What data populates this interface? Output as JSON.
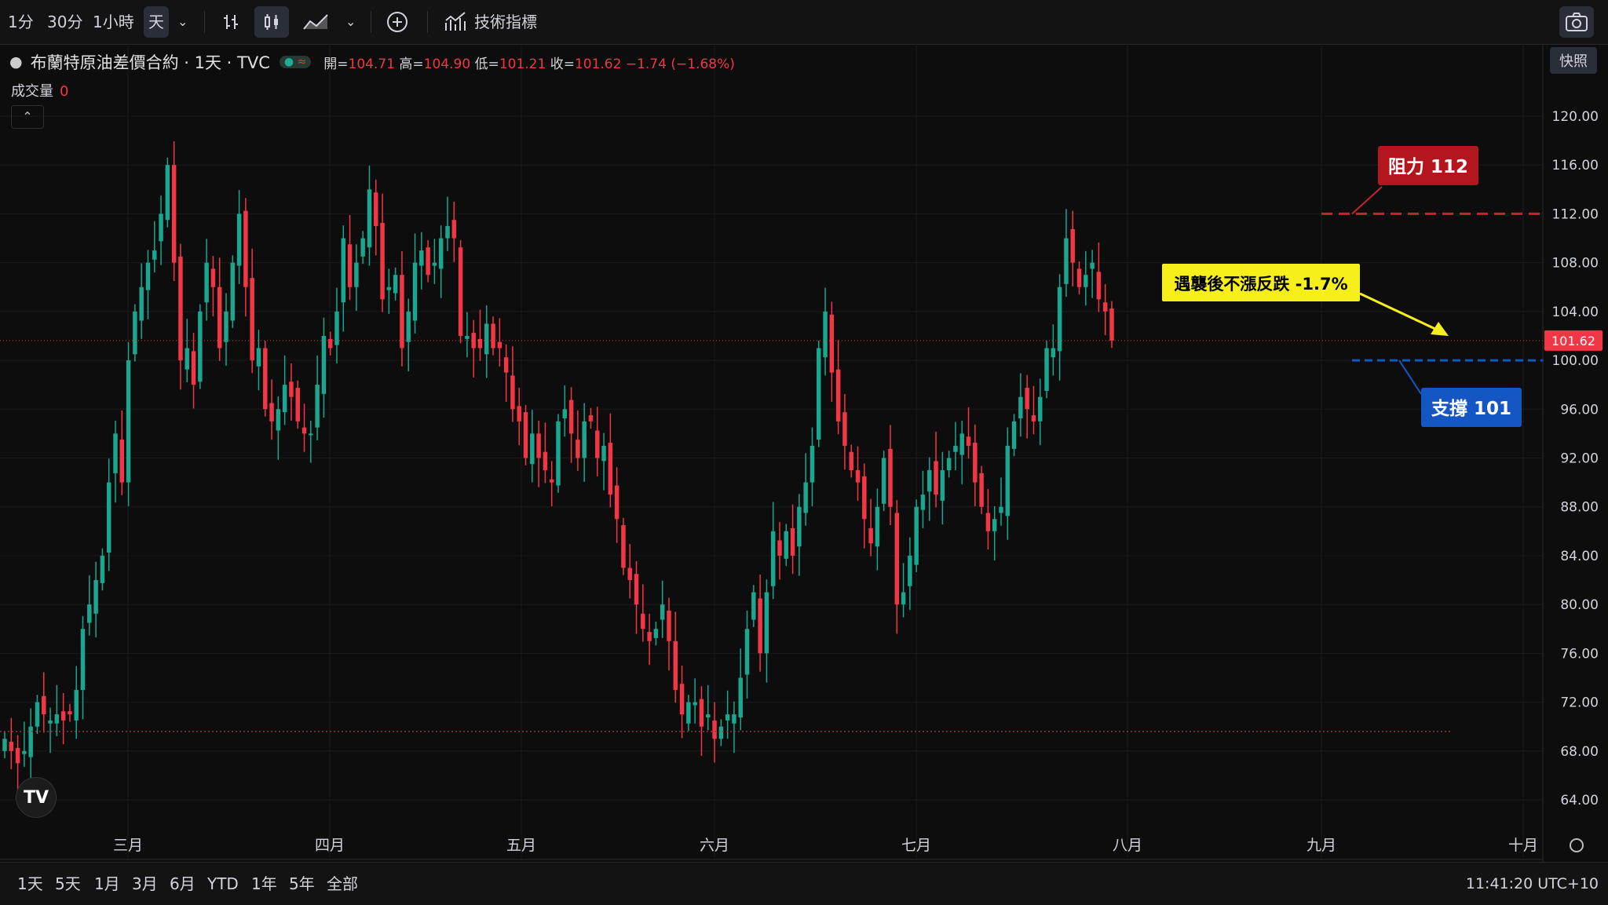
{
  "toolbar": {
    "intervals": [
      "1分",
      "30分",
      "1小時",
      "天"
    ],
    "active_interval": "天",
    "indicators_label": "技術指標",
    "snapshot_tooltip": "快照"
  },
  "legend": {
    "symbol": "布蘭特原油差價合約 · 1天 · TVC",
    "open_label": "開=",
    "open": "104.71",
    "high_label": "高=",
    "high": "104.90",
    "low_label": "低=",
    "low": "101.21",
    "close_label": "收=",
    "close": "101.62",
    "change": "−1.74 (−1.68%)"
  },
  "volume": {
    "label": "成交量",
    "value": "0"
  },
  "bottom": {
    "ranges": [
      "1天",
      "5天",
      "1月",
      "3月",
      "6月",
      "YTD",
      "1年",
      "5年",
      "全部"
    ],
    "clock": "11:41:20 UTC+10"
  },
  "colors": {
    "up": "#1aa68f",
    "down": "#f23645",
    "resistance": "#c4262e",
    "support": "#1456c4",
    "callout": "#f7ef1a"
  },
  "chart_data": {
    "type": "candlestick",
    "y_ticks": [
      "120.00",
      "116.00",
      "112.00",
      "108.00",
      "104.00",
      "100.00",
      "96.00",
      "92.00",
      "88.00",
      "84.00",
      "80.00",
      "76.00",
      "72.00",
      "68.00",
      "64.00"
    ],
    "x_ticks": [
      "三月",
      "四月",
      "五月",
      "六月",
      "七月",
      "八月",
      "九月",
      "十月"
    ],
    "ylim": [
      62,
      124
    ],
    "last_price": "101.62",
    "close_series": [
      69,
      68,
      67,
      68,
      70,
      72,
      71,
      70.5,
      71,
      70.5,
      71,
      73,
      78,
      80,
      82,
      84,
      90,
      94,
      90,
      100,
      104,
      106,
      108,
      109,
      112,
      116,
      108,
      100,
      101,
      98,
      104,
      108,
      106,
      101,
      104,
      108,
      112,
      106,
      100,
      101,
      96,
      95,
      96,
      98,
      97,
      95,
      94,
      94,
      98,
      102,
      101,
      104,
      110,
      106,
      108,
      110,
      114,
      111,
      105,
      106,
      107,
      101,
      104,
      108,
      109,
      107,
      108,
      110,
      111,
      110,
      102,
      102,
      101,
      101,
      103,
      101,
      101,
      99,
      96,
      95,
      92,
      94,
      92,
      91,
      90,
      95,
      96,
      94,
      92,
      95,
      95,
      92,
      93,
      89,
      87,
      83,
      82,
      80,
      78,
      77,
      78,
      80,
      77,
      73,
      71,
      72,
      72,
      70,
      71,
      69,
      70,
      71,
      71,
      74,
      78,
      81,
      76,
      81,
      86,
      84,
      86,
      84,
      88,
      90,
      93,
      101,
      104,
      99,
      95,
      93,
      91,
      90,
      87,
      85,
      88,
      92,
      88,
      80,
      81,
      84,
      88,
      89,
      91,
      89,
      91,
      92,
      93,
      94,
      93,
      90,
      88,
      86,
      87,
      88,
      93,
      95,
      97,
      96,
      95,
      97,
      101,
      101,
      106,
      110,
      108,
      106,
      107,
      108,
      105,
      104,
      101.62
    ],
    "annotations": {
      "resistance_label": "阻力 112",
      "support_label": "支撐 101",
      "callout": "遇襲後不漲反跌 -1.7%"
    }
  }
}
